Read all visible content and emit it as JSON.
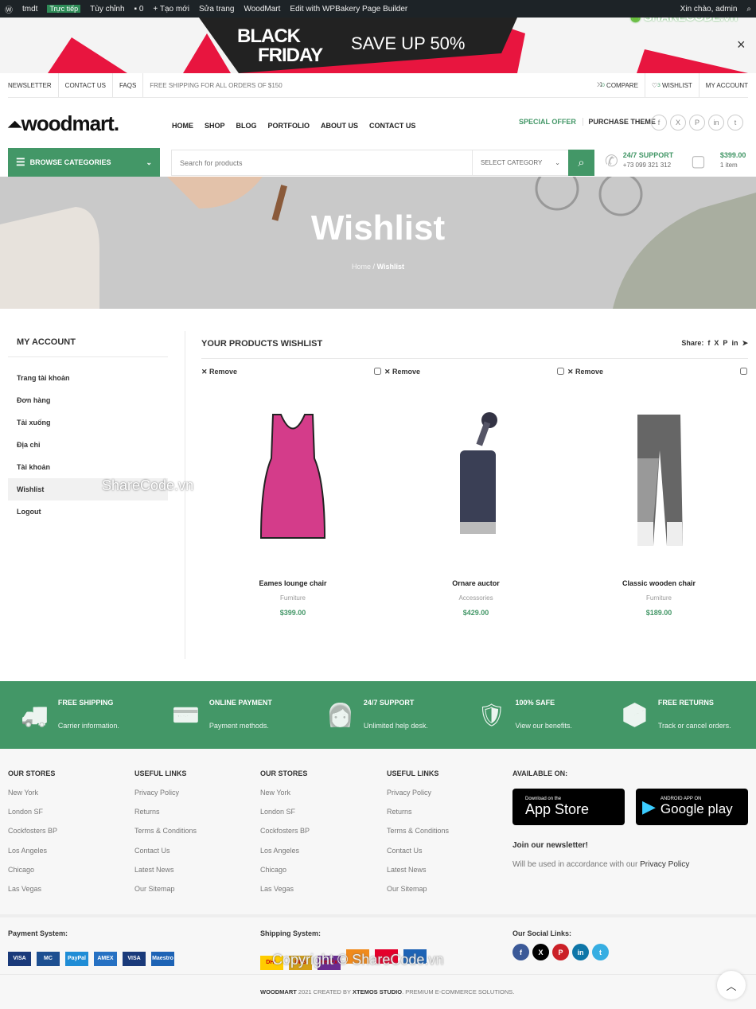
{
  "adminbar": {
    "site": "tmdt",
    "live": "Trực tiếp",
    "customize": "Tùy chỉnh",
    "comments": "0",
    "new": "Tạo mới",
    "edit": "Sửa trang",
    "theme": "WoodMart",
    "builder": "Edit with WPBakery Page Builder",
    "greeting": "Xin chào, admin"
  },
  "promo": {
    "line1": "BLACK",
    "line2": "FRIDAY",
    "save": "SAVE UP 50%",
    "close": "×"
  },
  "watermark": {
    "logo": "SHARECODE.vn",
    "mid": "ShareCode.vn",
    "copyright": "Copyright © ShareCode.vn"
  },
  "topbar": {
    "left": [
      "NEWSLETTER",
      "CONTACT US",
      "FAQS",
      "FREE SHIPPING FOR ALL ORDERS OF $150"
    ],
    "compare": "COMPARE",
    "compare_count": "0",
    "wishlist": "WISHLIST",
    "wishlist_count": "3",
    "account": "MY ACCOUNT"
  },
  "header": {
    "logo": "woodmart.",
    "nav": [
      "HOME",
      "SHOP",
      "BLOG",
      "PORTFOLIO",
      "ABOUT US",
      "CONTACT US"
    ],
    "special": "SPECIAL OFFER",
    "purchase": "PURCHASE THEME",
    "social": [
      "f",
      "X",
      "P",
      "in",
      "t"
    ]
  },
  "bar": {
    "browse": "BROWSE CATEGORIES",
    "search_placeholder": "Search for products",
    "category": "SELECT CATEGORY",
    "support_title": "24/7 SUPPORT",
    "support_phone": "+73 099 321 312",
    "cart_total": "$399.00",
    "cart_items": "1 item"
  },
  "hero": {
    "title": "Wishlist",
    "crumb_home": "Home",
    "crumb_sep": "/",
    "crumb_current": "Wishlist"
  },
  "sidebar": {
    "title": "MY ACCOUNT",
    "items": [
      "Trang tài khoản",
      "Đơn hàng",
      "Tải xuống",
      "Địa chỉ",
      "Tài khoản",
      "Wishlist",
      "Logout"
    ],
    "active": "Wishlist"
  },
  "wishlist": {
    "title": "YOUR PRODUCTS WISHLIST",
    "share": "Share:",
    "remove": "Remove",
    "products": [
      {
        "name": "Eames lounge chair",
        "category": "Furniture",
        "price": "$399.00"
      },
      {
        "name": "Ornare auctor",
        "category": "Accessories",
        "price": "$429.00"
      },
      {
        "name": "Classic wooden chair",
        "category": "Furniture",
        "price": "$189.00"
      }
    ]
  },
  "features": [
    {
      "title": "FREE SHIPPING",
      "text": "Carrier information."
    },
    {
      "title": "ONLINE PAYMENT",
      "text": "Payment methods."
    },
    {
      "title": "24/7 SUPPORT",
      "text": "Unlimited help desk."
    },
    {
      "title": "100% SAFE",
      "text": "View our benefits."
    },
    {
      "title": "FREE RETURNS",
      "text": "Track or cancel orders."
    }
  ],
  "footer": {
    "cols": [
      {
        "title": "OUR STORES",
        "links": [
          "New York",
          "London SF",
          "Cockfosters BP",
          "Los Angeles",
          "Chicago",
          "Las Vegas"
        ]
      },
      {
        "title": "USEFUL LINKS",
        "links": [
          "Privacy Policy",
          "Returns",
          "Terms & Conditions",
          "Contact Us",
          "Latest News",
          "Our Sitemap"
        ]
      },
      {
        "title": "OUR STORES",
        "links": [
          "New York",
          "London SF",
          "Cockfosters BP",
          "Los Angeles",
          "Chicago",
          "Las Vegas"
        ]
      },
      {
        "title": "USEFUL LINKS",
        "links": [
          "Privacy Policy",
          "Returns",
          "Terms & Conditions",
          "Contact Us",
          "Latest News",
          "Our Sitemap"
        ]
      }
    ],
    "available": "AVAILABLE ON:",
    "appstore_small": "Download on the",
    "appstore": "App Store",
    "gplay_small": "ANDROID APP ON",
    "gplay": "Google play",
    "newsletter": "Join our newsletter!",
    "newsletter_text": "Will be used in accordance with our",
    "privacy": "Privacy Policy",
    "payment": "Payment System:",
    "pay_logos": [
      "VISA",
      "MC",
      "PayPal",
      "AMEX",
      "VISA",
      "Maestro"
    ],
    "shipping": "Shipping System:",
    "ship_logos": [
      "DHL",
      "UPS",
      "FedEx",
      "",
      "",
      ""
    ],
    "social": "Our Social Links:",
    "social_icons": [
      "f",
      "X",
      "P",
      "in",
      "t"
    ],
    "copy_brand": "WOODMART",
    "copy_mid": " 2021 CREATED BY ",
    "copy_studio": "XTEMOS STUDIO",
    "copy_end": ". PREMIUM E-COMMERCE SOLUTIONS."
  },
  "colors": {
    "accent": "#439767",
    "adminbar": "#1d2327",
    "promo_red": "#e8153f"
  }
}
